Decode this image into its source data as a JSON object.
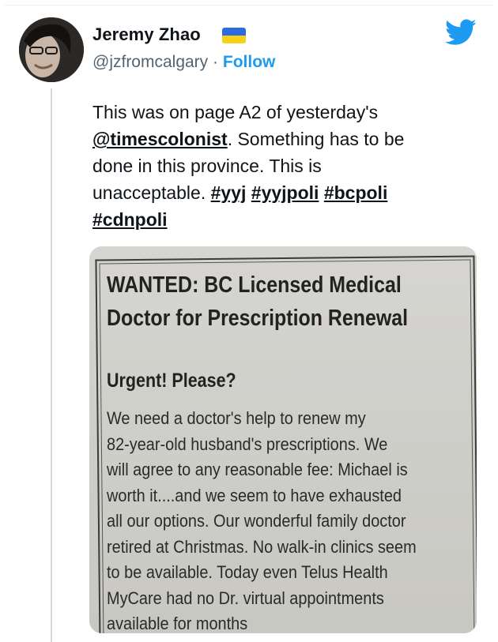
{
  "author": {
    "name": "Jeremy Zhao",
    "handle": "@jzfromcalgary",
    "separator": "·",
    "follow_label": "Follow",
    "flag_colors": [
      "#2d6be0",
      "#f7d117"
    ]
  },
  "brand": {
    "icon": "twitter-bird-icon",
    "color": "#1d9bf0"
  },
  "tweet": {
    "line1": "This was on page A2 of yesterday's",
    "mention": "@timescolonist",
    "line2_rest": ". Something has to be",
    "line3": "done in this province. This is",
    "line4_prefix": "unacceptable. ",
    "hashtags": [
      "#yyj",
      "#yyjpoli",
      "#bcpoli",
      "#cdnpoli"
    ]
  },
  "newspaper_ad": {
    "headline_line1": "WANTED:  BC Licensed Medical",
    "headline_line2": "Doctor for Prescription Renewal",
    "subhead": "Urgent! Please?",
    "body_lines": [
      "We need a doctor's help to renew my",
      "82-year-old husband's prescriptions. We",
      "will agree to any reasonable fee: Michael is",
      "worth it....and we seem to have exhausted",
      "all our options. Our wonderful family doctor",
      "retired at Christmas. No walk-in clinics seem",
      "to be available. Today even Telus Health",
      "MyCare had no Dr. virtual appointments",
      "available for months"
    ]
  }
}
